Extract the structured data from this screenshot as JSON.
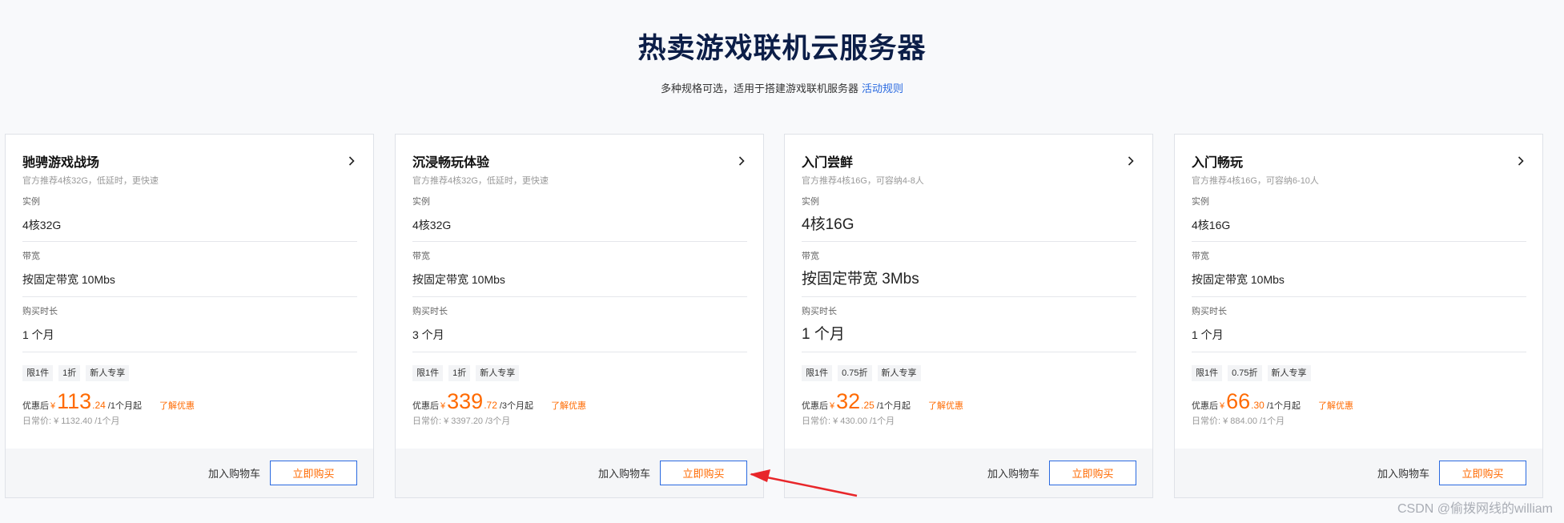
{
  "header": {
    "title": "热卖游戏联机云服务器",
    "subtitle": "多种规格可选，适用于搭建游戏联机服务器",
    "rule_link": "活动规则"
  },
  "labels": {
    "instance": "实例",
    "bandwidth": "带宽",
    "duration": "购买时长",
    "price_prefix": "优惠后",
    "currency": "¥",
    "learn_discount": "了解优惠",
    "add_to_cart": "加入购物车",
    "buy_now": "立即购买"
  },
  "cards": [
    {
      "title": "驰骋游戏战场",
      "desc": "官方推荐4核32G，低延时，更快速",
      "instance": "4核32G",
      "bandwidth": "按固定带宽 10Mbs",
      "duration": "1 个月",
      "tags": [
        "限1件",
        "1折",
        "新人专享"
      ],
      "price_int": "113",
      "price_dec": ".24",
      "price_period": "/1个月起",
      "original_price": "日常价: ¥ 1132.40 /1个月"
    },
    {
      "title": "沉浸畅玩体验",
      "desc": "官方推荐4核32G，低延时，更快速",
      "instance": "4核32G",
      "bandwidth": "按固定带宽 10Mbs",
      "duration": "3 个月",
      "tags": [
        "限1件",
        "1折",
        "新人专享"
      ],
      "price_int": "339",
      "price_dec": ".72",
      "price_period": "/3个月起",
      "original_price": "日常价: ¥ 3397.20 /3个月"
    },
    {
      "title": "入门尝鲜",
      "desc": "官方推荐4核16G，可容纳4-8人",
      "instance": "4核16G",
      "bandwidth": "按固定带宽 3Mbs",
      "duration": "1 个月",
      "tags": [
        "限1件",
        "0.75折",
        "新人专享"
      ],
      "price_int": "32",
      "price_dec": ".25",
      "price_period": "/1个月起",
      "original_price": "日常价: ¥ 430.00 /1个月"
    },
    {
      "title": "入门畅玩",
      "desc": "官方推荐4核16G，可容纳6-10人",
      "instance": "4核16G",
      "bandwidth": "按固定带宽 10Mbs",
      "duration": "1 个月",
      "tags": [
        "限1件",
        "0.75折",
        "新人专享"
      ],
      "price_int": "66",
      "price_dec": ".30",
      "price_period": "/1个月起",
      "original_price": "日常价: ¥ 884.00 /1个月"
    }
  ],
  "colors": {
    "accent_orange": "#ff6a00",
    "link_blue": "#2a6ae0",
    "title_navy": "#0c1e48",
    "annotation_red": "#e8262a"
  },
  "watermark": "CSDN @偷拨网线的william"
}
